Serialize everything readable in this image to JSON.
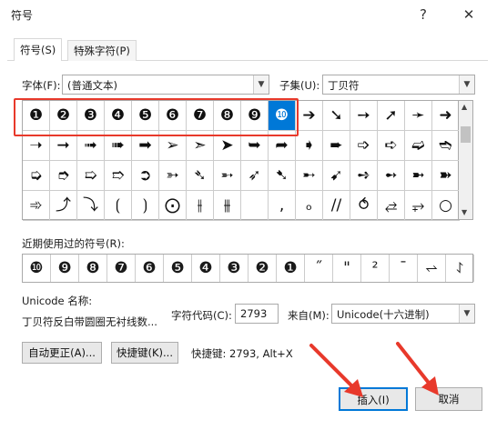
{
  "window": {
    "title": "符号",
    "help": "?",
    "close": "✕"
  },
  "tabs": [
    {
      "label": "符号(S)"
    },
    {
      "label": "特殊字符(P)"
    }
  ],
  "font": {
    "label": "字体(F):",
    "value": "(普通文本)"
  },
  "subset": {
    "label": "子集(U):",
    "value": "丁贝符"
  },
  "symbol_rows": [
    [
      "❶",
      "❷",
      "❸",
      "❹",
      "❺",
      "❻",
      "❼",
      "❽",
      "❾",
      "❿",
      "➔",
      "➘",
      "➙",
      "➚",
      "➛",
      "➜"
    ],
    [
      "➝",
      "➞",
      "➟",
      "➠",
      "➡",
      "➢",
      "➣",
      "➤",
      "➥",
      "➦",
      "➧",
      "➨",
      "➩",
      "➪",
      "➫",
      "➬"
    ],
    [
      "➭",
      "➮",
      "➯",
      "➱",
      "➲",
      "➳",
      "➴",
      "➵",
      "➶",
      "➷",
      "➸",
      "➹",
      "➺",
      "➻",
      "➼",
      "➽"
    ],
    [
      "➾",
      "⤴",
      "⤵",
      "⟮",
      "⟯",
      "⨀",
      "⫲",
      "⫵",
      "",
      "‚",
      "ₒ",
      "//",
      "⥀",
      "⥄",
      "⥅",
      "○"
    ]
  ],
  "selected_symbol": "❿",
  "recent": {
    "label": "近期使用过的符号(R):",
    "symbols": [
      "❿",
      "❾",
      "❽",
      "❼",
      "❻",
      "❺",
      "❹",
      "❸",
      "❷",
      "❶",
      "˝",
      "\"",
      "²",
      "¯",
      "⥋",
      "⥌"
    ]
  },
  "unicode_name": {
    "label": "Unicode 名称:",
    "value": "丁贝符反白带圆圈无衬线数..."
  },
  "char_code": {
    "label": "字符代码(C):",
    "value": "2793"
  },
  "from": {
    "label": "来自(M):",
    "value": "Unicode(十六进制)"
  },
  "buttons": {
    "autocorrect": "自动更正(A)...",
    "shortcut_key": "快捷键(K)...",
    "shortcut_info": "快捷键: 2793, Alt+X",
    "insert": "插入(I)",
    "cancel": "取消"
  },
  "colors": {
    "accent": "#0078d7",
    "highlight": "#e8392b"
  }
}
